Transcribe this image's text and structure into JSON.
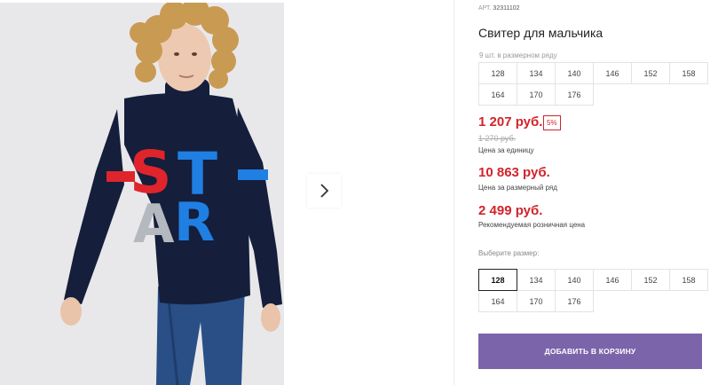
{
  "product": {
    "article_label": "АРТ.",
    "article_value": "32311102",
    "title": "Свитер для мальчика",
    "count_in_set": "9 шт. в размерном ряду"
  },
  "size_range": [
    "128",
    "134",
    "140",
    "146",
    "152",
    "158",
    "164",
    "170",
    "176"
  ],
  "prices": {
    "main": "1 207 руб.",
    "discount_badge": "5%",
    "old": "1 270 руб.",
    "unit_label": "Цена за единицу",
    "set": "10 863 руб.",
    "set_label": "Цена за размерный ряд",
    "rrp": "2 499 руб.",
    "rrp_label": "Рекомендуемая розничная цена"
  },
  "size_picker": {
    "label": "Выберите размер:",
    "selected": "128",
    "options": [
      "128",
      "134",
      "140",
      "146",
      "152",
      "158",
      "164",
      "170",
      "176"
    ]
  },
  "cart_button": "ДОБАВИТЬ В КОРЗИНУ",
  "sweater_letters": [
    "S",
    "T",
    "A",
    "R"
  ],
  "colors": {
    "price_red": "#d2232a",
    "button_purple": "#7b64a9",
    "sweater_navy": "#151e3b",
    "letter_red": "#e0242b",
    "letter_blue": "#1f7fe3",
    "letter_grey": "#b4b9c0"
  },
  "icons": {
    "next": "chevron-right-icon"
  }
}
